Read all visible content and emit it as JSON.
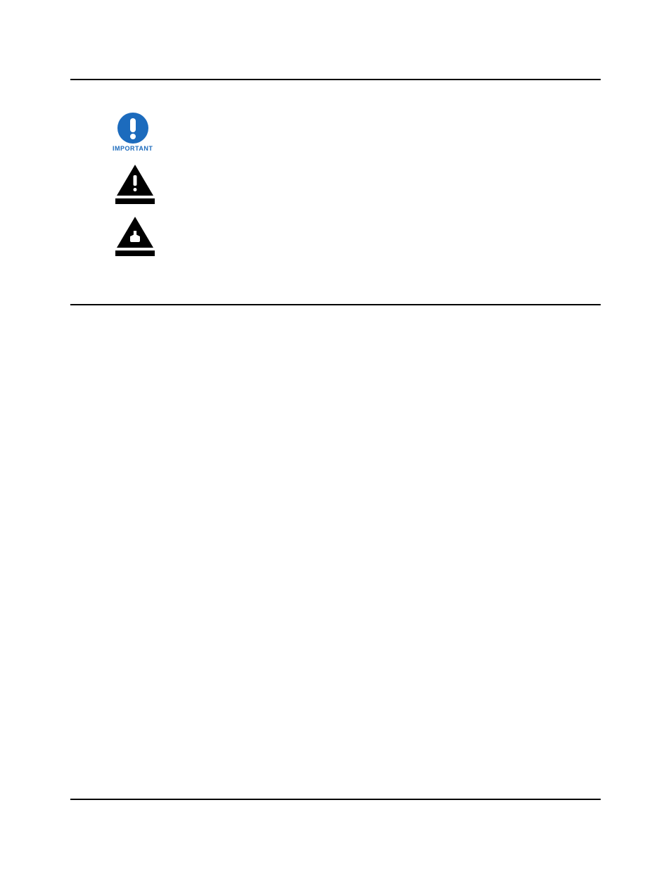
{
  "icons": {
    "important_label": "IMPORTANT"
  }
}
